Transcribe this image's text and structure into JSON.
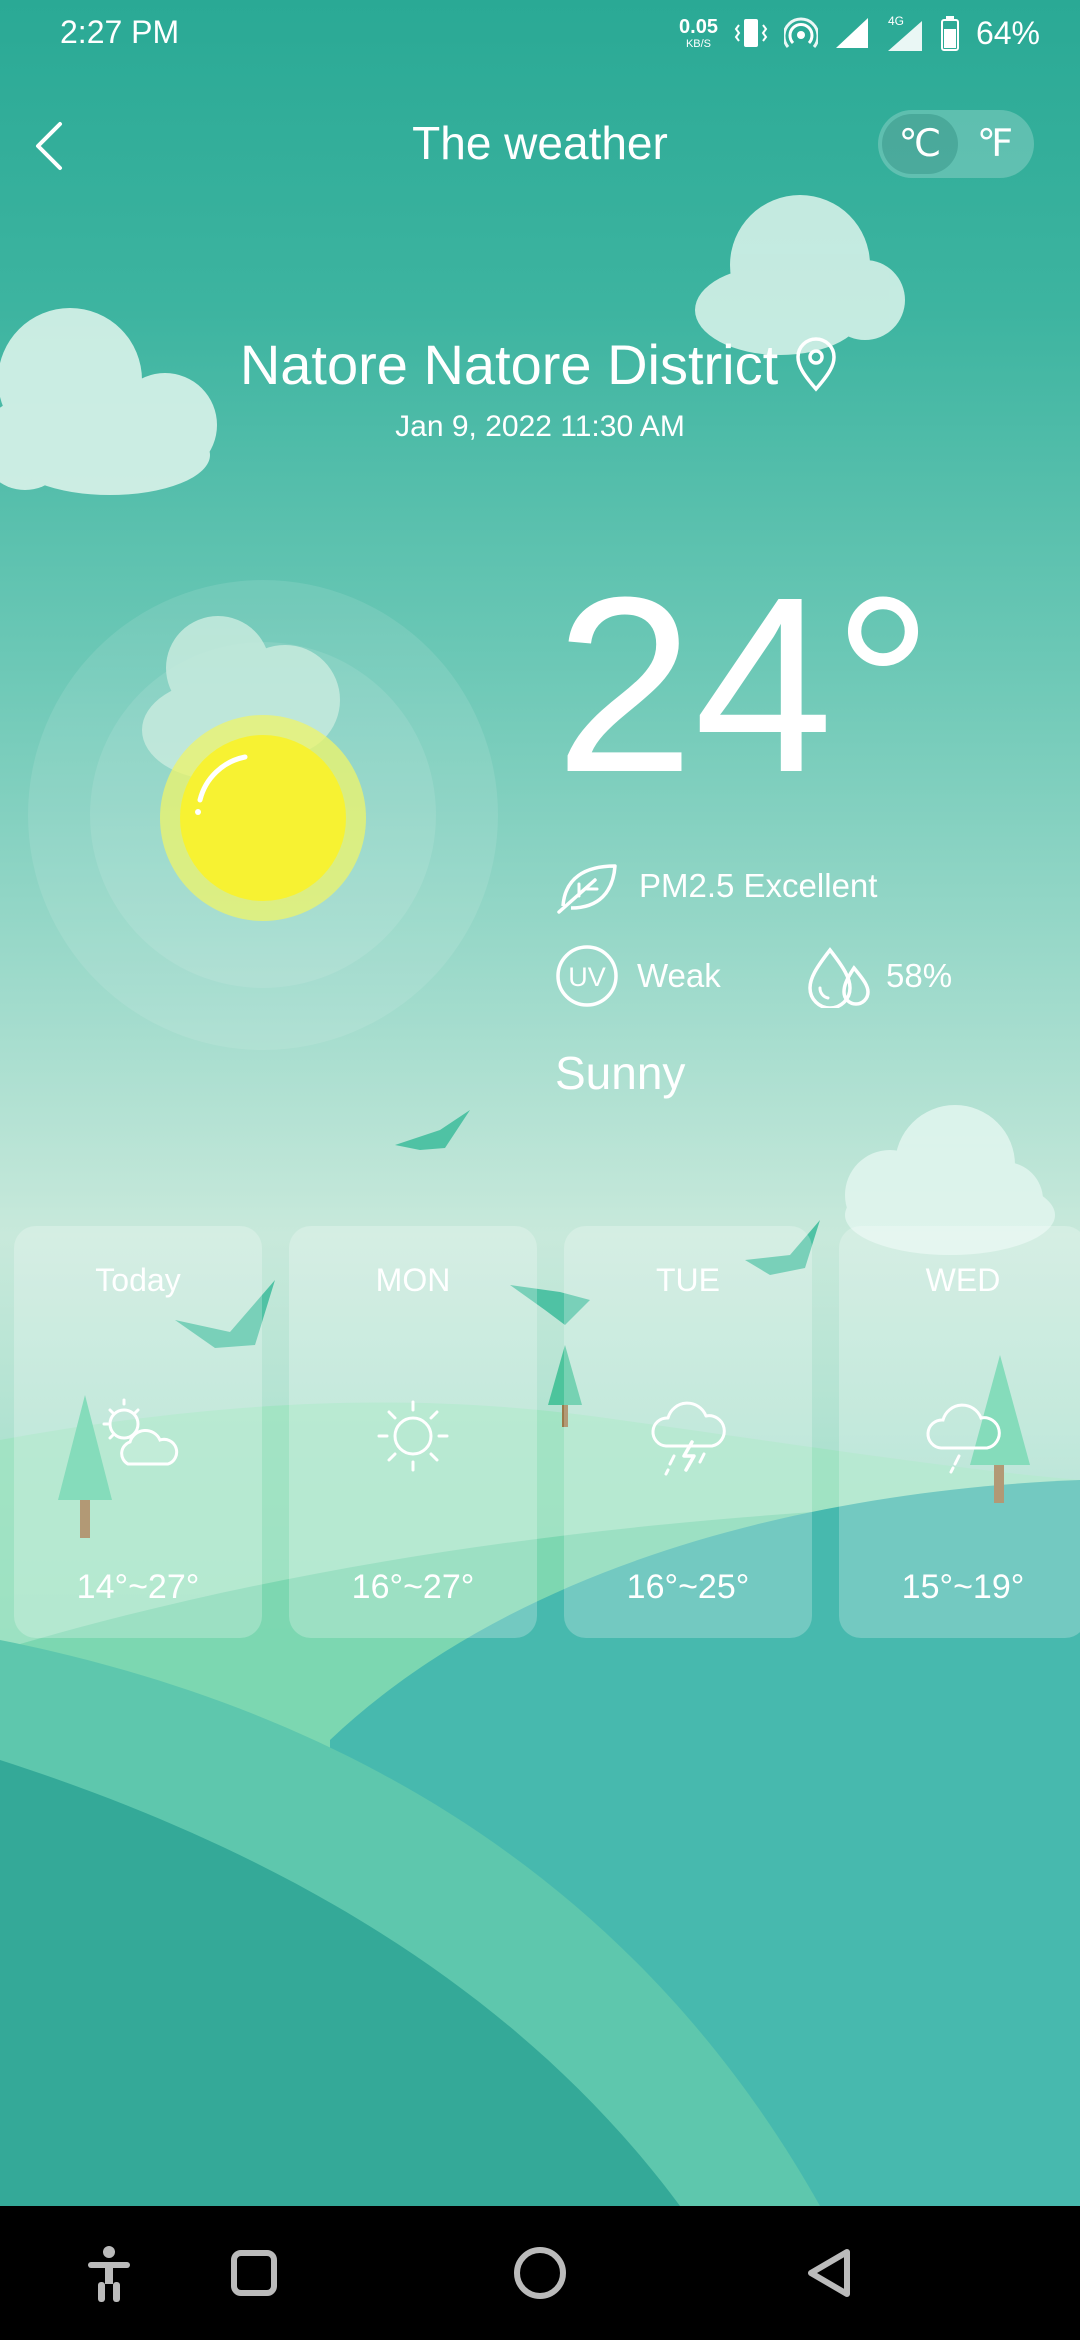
{
  "status_bar": {
    "time": "2:27 PM",
    "net_speed_value": "0.05",
    "net_speed_unit": "KB/S",
    "network_type": "4G",
    "battery": "64%",
    "icons": [
      "vibrate-icon",
      "hotspot-icon",
      "signal-icon",
      "signal-4g-icon",
      "battery-icon"
    ]
  },
  "header": {
    "title": "The weather",
    "back_icon": "chevron-left-icon",
    "unit_celsius": "℃",
    "unit_fahrenheit": "℉",
    "selected_unit": "celsius"
  },
  "location": {
    "name": "Natore Natore District",
    "icon": "location-pin-icon",
    "datetime": "Jan 9, 2022 11:30 AM"
  },
  "current": {
    "temperature": "24°",
    "pm25_label": "PM2.5 Excellent",
    "uv_badge": "UV",
    "uv_label": "Weak",
    "humidity": "58%",
    "condition": "Sunny",
    "icon": "sun-icon"
  },
  "forecast": [
    {
      "day": "Today",
      "range": "14°~27°",
      "icon": "partly-cloudy-icon"
    },
    {
      "day": "MON",
      "range": "16°~27°",
      "icon": "sun-icon"
    },
    {
      "day": "TUE",
      "range": "16°~25°",
      "icon": "thunderstorm-icon"
    },
    {
      "day": "WED",
      "range": "15°~19°",
      "icon": "light-rain-icon"
    }
  ],
  "nav_bar": {
    "icons": [
      "accessibility-icon",
      "recents-icon",
      "home-icon",
      "back-icon"
    ]
  },
  "colors": {
    "background_top": "#2aa995",
    "background_mid": "#c8e9db",
    "sun": "#f7f232",
    "hill_green": "#8fe0b3",
    "hill_teal": "#3fb8a6"
  }
}
